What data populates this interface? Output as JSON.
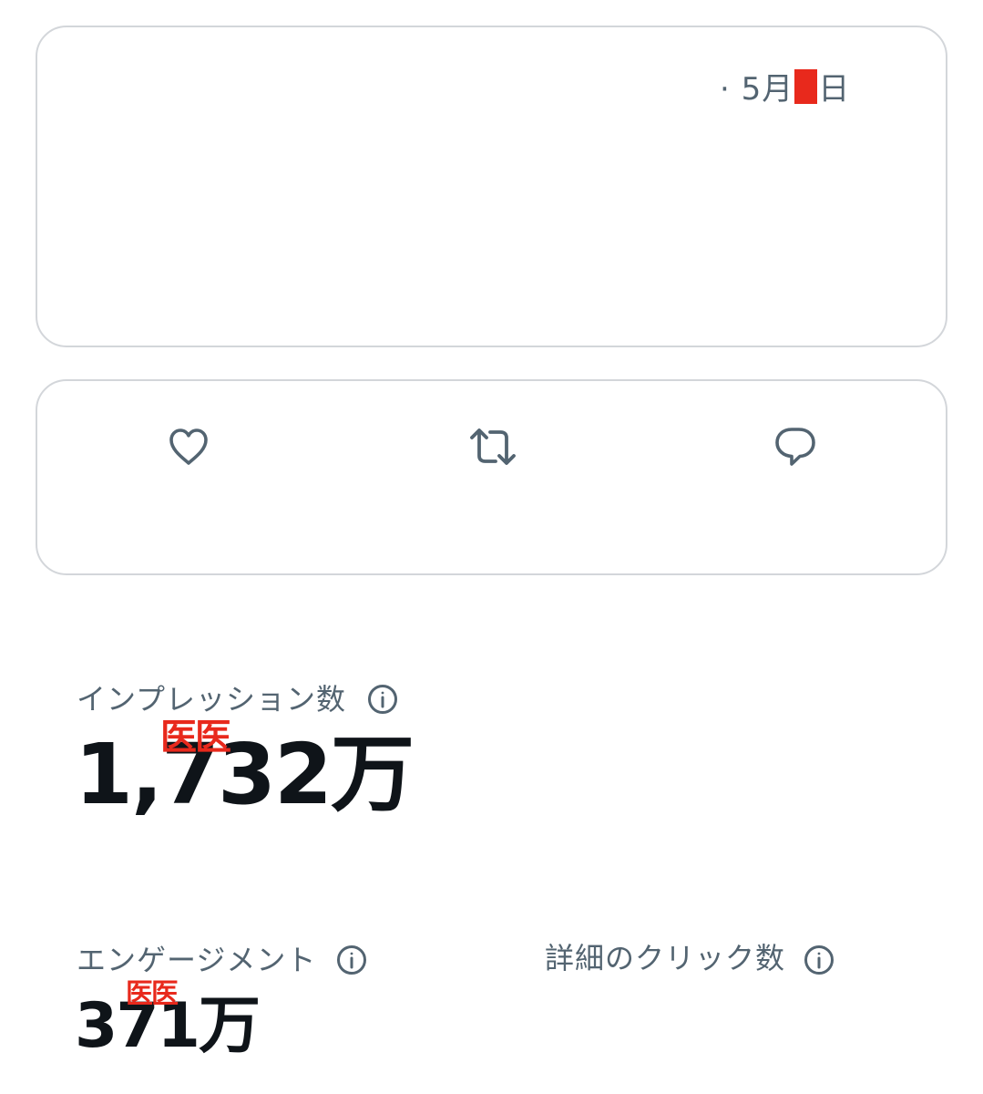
{
  "tweet": {
    "date_prefix": "· 5月",
    "date_suffix": "日"
  },
  "actions": [
    {
      "name": "like",
      "icon": "heart-icon"
    },
    {
      "name": "retweet",
      "icon": "retweet-icon"
    },
    {
      "name": "reply",
      "icon": "reply-icon"
    }
  ],
  "metrics": {
    "impressions": {
      "label": "インプレッション数",
      "value": "1,732万",
      "stamp": "医医",
      "icon": "info-icon"
    },
    "engagement": {
      "label": "エンゲージメント",
      "value": "371万",
      "stamp": "医医",
      "icon": "info-icon"
    },
    "detail_clicks": {
      "label": "詳細のクリック数",
      "icon": "info-icon"
    }
  },
  "colors": {
    "text_primary": "#0f1419",
    "text_secondary": "#536471",
    "border": "#d3d6da",
    "redaction": "#e8291c"
  }
}
